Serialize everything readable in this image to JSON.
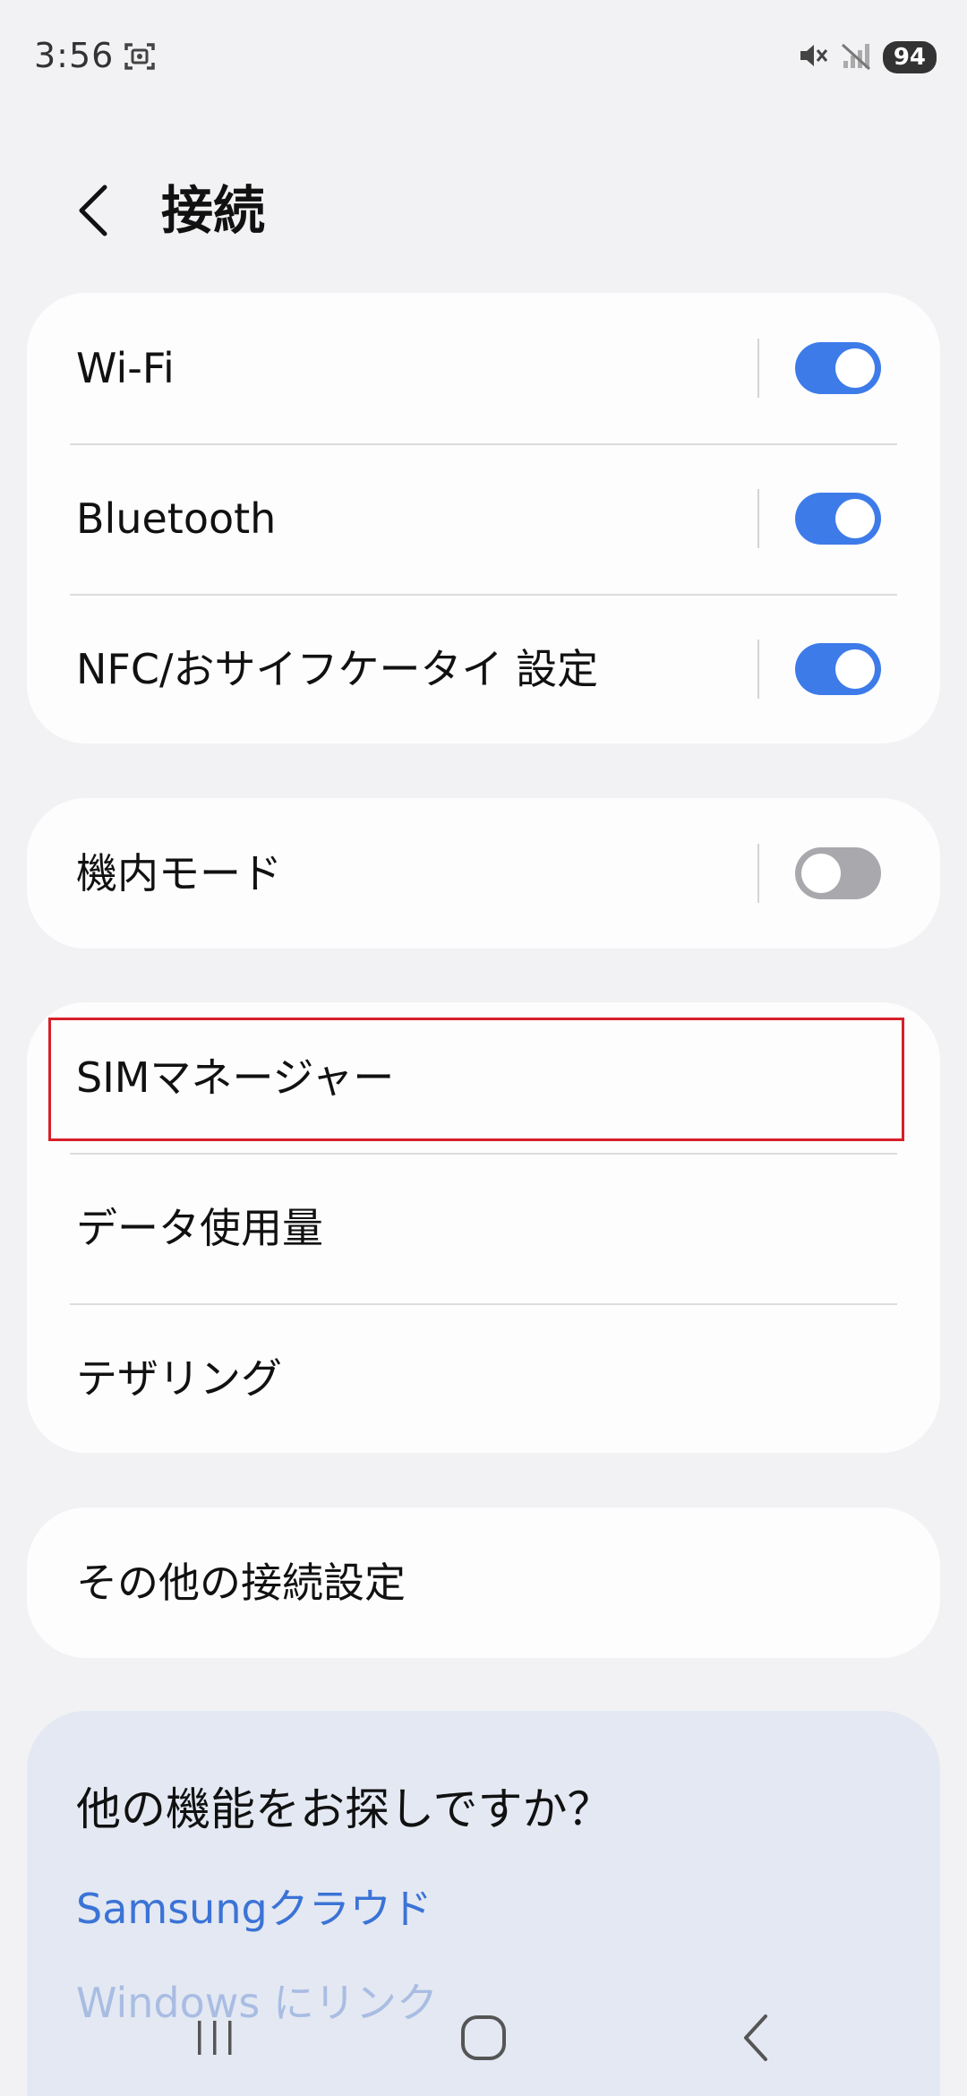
{
  "status_bar": {
    "time": "3:56",
    "battery": "94",
    "icons": [
      "screenshot-icon",
      "mute-icon",
      "no-signal-icon",
      "battery-icon"
    ]
  },
  "header": {
    "title": "接続",
    "back_icon": "chevron-left-icon"
  },
  "groups": [
    {
      "items": [
        {
          "label": "Wi-Fi",
          "toggle": true,
          "state": "on"
        },
        {
          "label": "Bluetooth",
          "toggle": true,
          "state": "on"
        },
        {
          "label": "NFC/おサイフケータイ 設定",
          "toggle": true,
          "state": "on"
        }
      ]
    },
    {
      "items": [
        {
          "label": "機内モード",
          "toggle": true,
          "state": "off"
        }
      ]
    },
    {
      "items": [
        {
          "label": "SIMマネージャー",
          "toggle": false,
          "highlighted": true
        },
        {
          "label": "データ使用量",
          "toggle": false
        },
        {
          "label": "テザリング",
          "toggle": false
        }
      ]
    },
    {
      "items": [
        {
          "label": "その他の接続設定",
          "toggle": false
        }
      ]
    }
  ],
  "suggestions": {
    "title": "他の機能をお探しですか？",
    "links": [
      "Samsungクラウド",
      "Windows にリンク"
    ]
  },
  "nav": {
    "buttons": [
      "recents-icon",
      "home-icon",
      "back-icon"
    ]
  },
  "colors": {
    "accent": "#3d7be9",
    "toggle_off": "#a9a9ad",
    "highlight": "#d6202a",
    "link": "#3b73d6"
  }
}
